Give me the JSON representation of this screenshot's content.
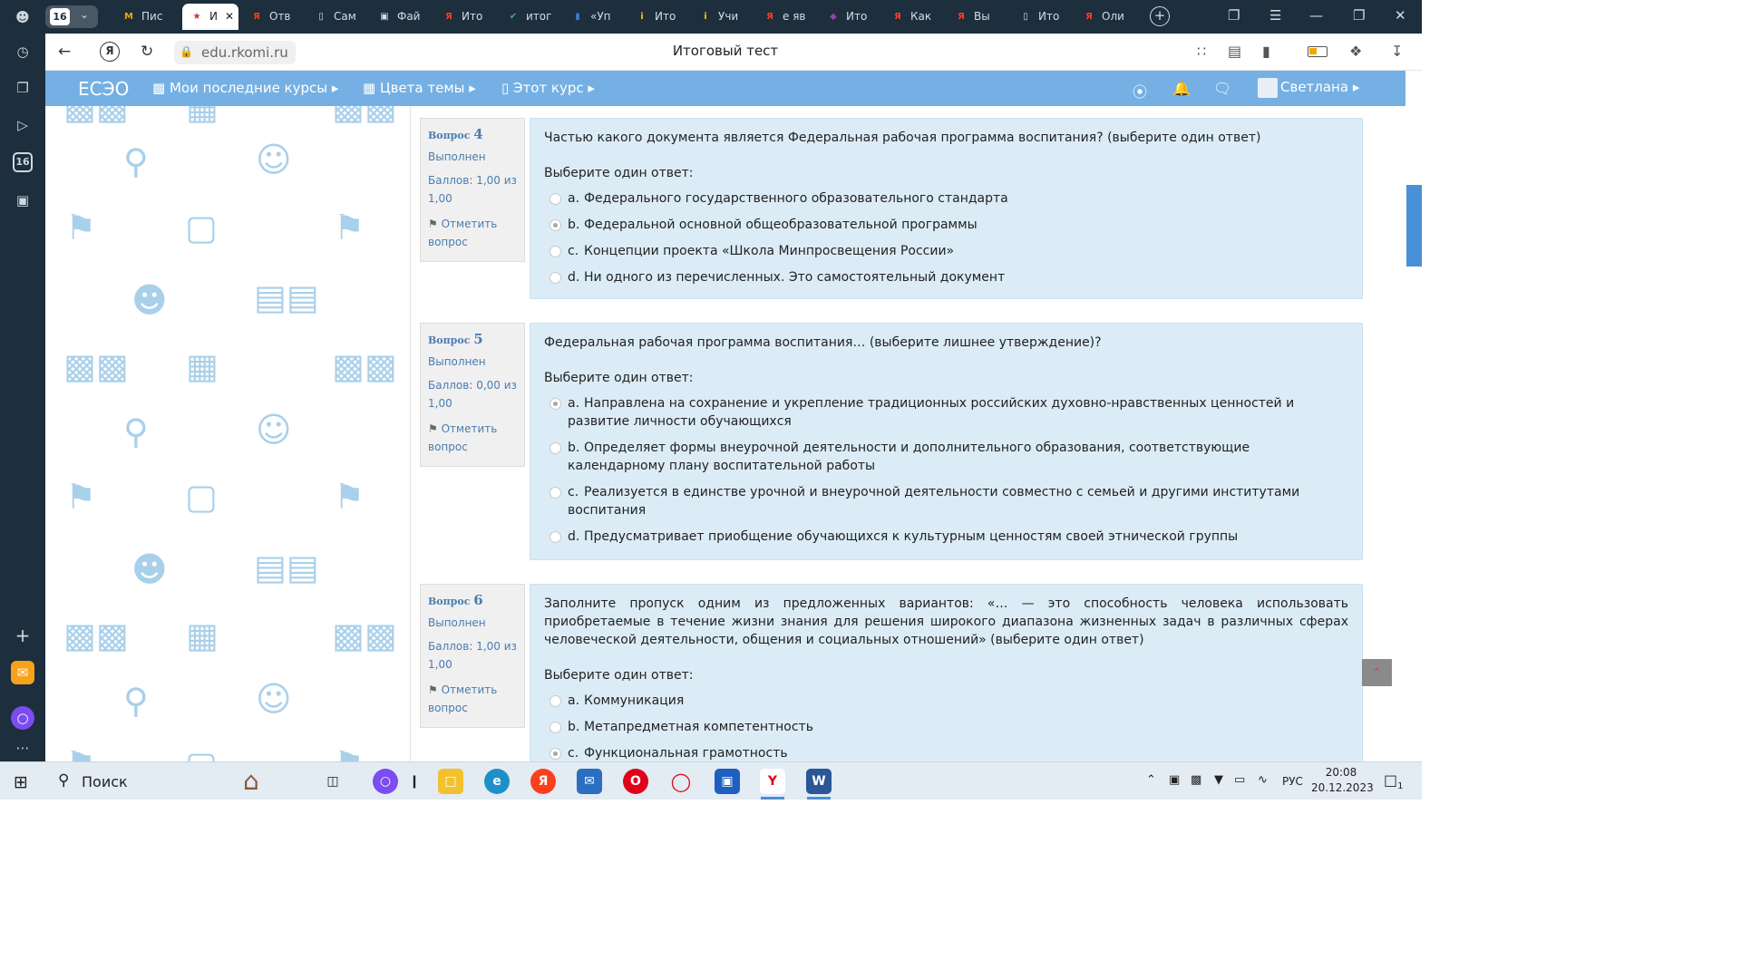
{
  "browser": {
    "tab_count": "16",
    "tabs": [
      {
        "label": "Пис",
        "icon": "gmail-icon",
        "color": "#f2a600"
      },
      {
        "label": "И",
        "icon": "emblem-icon",
        "color": "#c0392b",
        "active": true
      },
      {
        "label": "Отв",
        "icon": "yandex-icon",
        "color": "#fc3f1d"
      },
      {
        "label": "Сам",
        "icon": "document-icon",
        "color": "#d6dde3"
      },
      {
        "label": "Фай",
        "icon": "save-icon",
        "color": "#d6dde3"
      },
      {
        "label": "Ито",
        "icon": "yandex-icon",
        "color": "#fc3f1d"
      },
      {
        "label": "итог",
        "icon": "check-icon",
        "color": "#3cb371"
      },
      {
        "label": "«Уп",
        "icon": "book-icon",
        "color": "#3a7bd5"
      },
      {
        "label": "Ито",
        "icon": "info-icon",
        "color": "#f1c40f"
      },
      {
        "label": "Учи",
        "icon": "info-icon",
        "color": "#f1c40f"
      },
      {
        "label": "е яв",
        "icon": "yandex-icon",
        "color": "#fc3f1d"
      },
      {
        "label": "Ито",
        "icon": "app-icon",
        "color": "#8e44ad"
      },
      {
        "label": "Как",
        "icon": "yandex-icon",
        "color": "#fc3f1d"
      },
      {
        "label": "Вы",
        "icon": "yandex-icon",
        "color": "#fc3f1d"
      },
      {
        "label": "Ито",
        "icon": "document-icon",
        "color": "#d6dde3"
      },
      {
        "label": "Оли",
        "icon": "yandex-icon",
        "color": "#fc3f1d"
      }
    ],
    "url": "edu.rkomi.ru",
    "page_title": "Итоговый тест"
  },
  "navbar": {
    "brand": "ЕСЭО",
    "my_courses": "Мои последние курсы",
    "theme_colors": "Цвета темы",
    "this_course": "Этот курс",
    "user_name": "Светлана"
  },
  "questions": [
    {
      "label": "Вопрос",
      "number": "4",
      "state": "Выполнен",
      "grade": "Баллов: 1,00 из 1,00",
      "flag": "Отметить вопрос",
      "text": "Частью какого документа является Федеральная рабочая программа воспитания? (выберите один ответ)",
      "prompt": "Выберите один ответ:",
      "options": [
        {
          "letter": "a.",
          "text": "Федерального государственного образовательного стандарта",
          "checked": false
        },
        {
          "letter": "b.",
          "text": "Федеральной основной общеобразовательной программы",
          "checked": true
        },
        {
          "letter": "c.",
          "text": "Концепции проекта «Школа Минпросвещения России»",
          "checked": false
        },
        {
          "letter": "d.",
          "text": "Ни одного из перечисленных. Это самостоятельный документ",
          "checked": false
        }
      ]
    },
    {
      "label": "Вопрос",
      "number": "5",
      "state": "Выполнен",
      "grade": "Баллов: 0,00 из 1,00",
      "flag": "Отметить вопрос",
      "text": "Федеральная рабочая программа воспитания… (выберите лишнее утверждение)?",
      "prompt": "Выберите один ответ:",
      "options": [
        {
          "letter": "a.",
          "text": "Направлена на сохранение и укрепление традиционных российских духовно-нравственных ценностей и развитие личности обучающихся",
          "checked": true
        },
        {
          "letter": "b.",
          "text": "Определяет формы внеурочной деятельности и дополнительного образования, соответствующие календарному плану воспитательной работы",
          "checked": false
        },
        {
          "letter": "c.",
          "text": "Реализуется в единстве урочной и внеурочной деятельности совместно с семьей и другими институтами воспитания",
          "checked": false
        },
        {
          "letter": "d.",
          "text": "Предусматривает приобщение обучающихся к культурным ценностям своей этнической группы",
          "checked": false
        }
      ]
    },
    {
      "label": "Вопрос",
      "number": "6",
      "state": "Выполнен",
      "grade": "Баллов: 1,00 из 1,00",
      "flag": "Отметить вопрос",
      "text": "Заполните пропуск одним из предложенных вариантов: «… — это способность человека использовать приобретаемые в течение жизни знания для решения широкого диапазона жизненных задач в различных сферах человеческой деятельности, общения и социальных отношений» (выберите один ответ)",
      "prompt": "Выберите один ответ:",
      "options": [
        {
          "letter": "a.",
          "text": "Коммуникация",
          "checked": false
        },
        {
          "letter": "b.",
          "text": "Метапредметная компетентность",
          "checked": false
        },
        {
          "letter": "c.",
          "text": "Функциональная грамотность",
          "checked": true
        }
      ]
    }
  ],
  "taskbar": {
    "search_label": "Поиск",
    "language": "РУС",
    "time": "20:08",
    "date": "20.12.2023",
    "notifications": "1"
  }
}
